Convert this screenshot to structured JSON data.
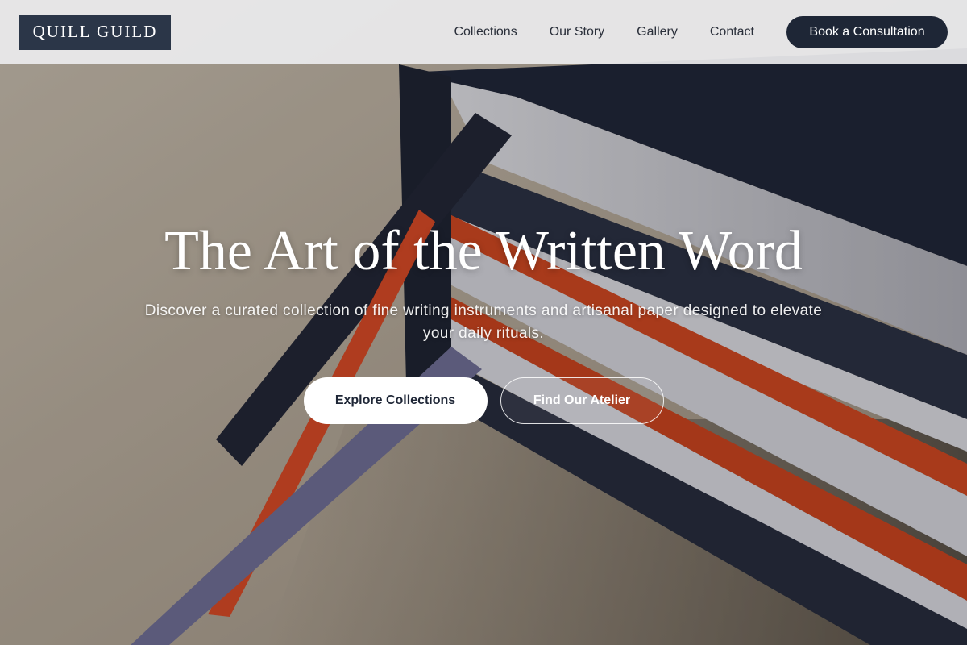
{
  "brand": {
    "logo_text": "QUILL GUILD"
  },
  "nav": {
    "links": [
      "Collections",
      "Our Story",
      "Gallery",
      "Contact"
    ],
    "cta_label": "Book a Consultation"
  },
  "hero": {
    "title": "The Art of the Written Word",
    "subtitle": "Discover a curated collection of fine writing instruments and artisanal paper designed to elevate your daily rituals.",
    "primary_button": "Explore Collections",
    "secondary_button": "Find Our Atelier"
  },
  "colors": {
    "navy": "#1e2636",
    "logo_bg": "#2b3648",
    "ribbon_orange": "#d4471d",
    "ribbon_lavender": "#6e6d93",
    "table": "#b3a898"
  }
}
